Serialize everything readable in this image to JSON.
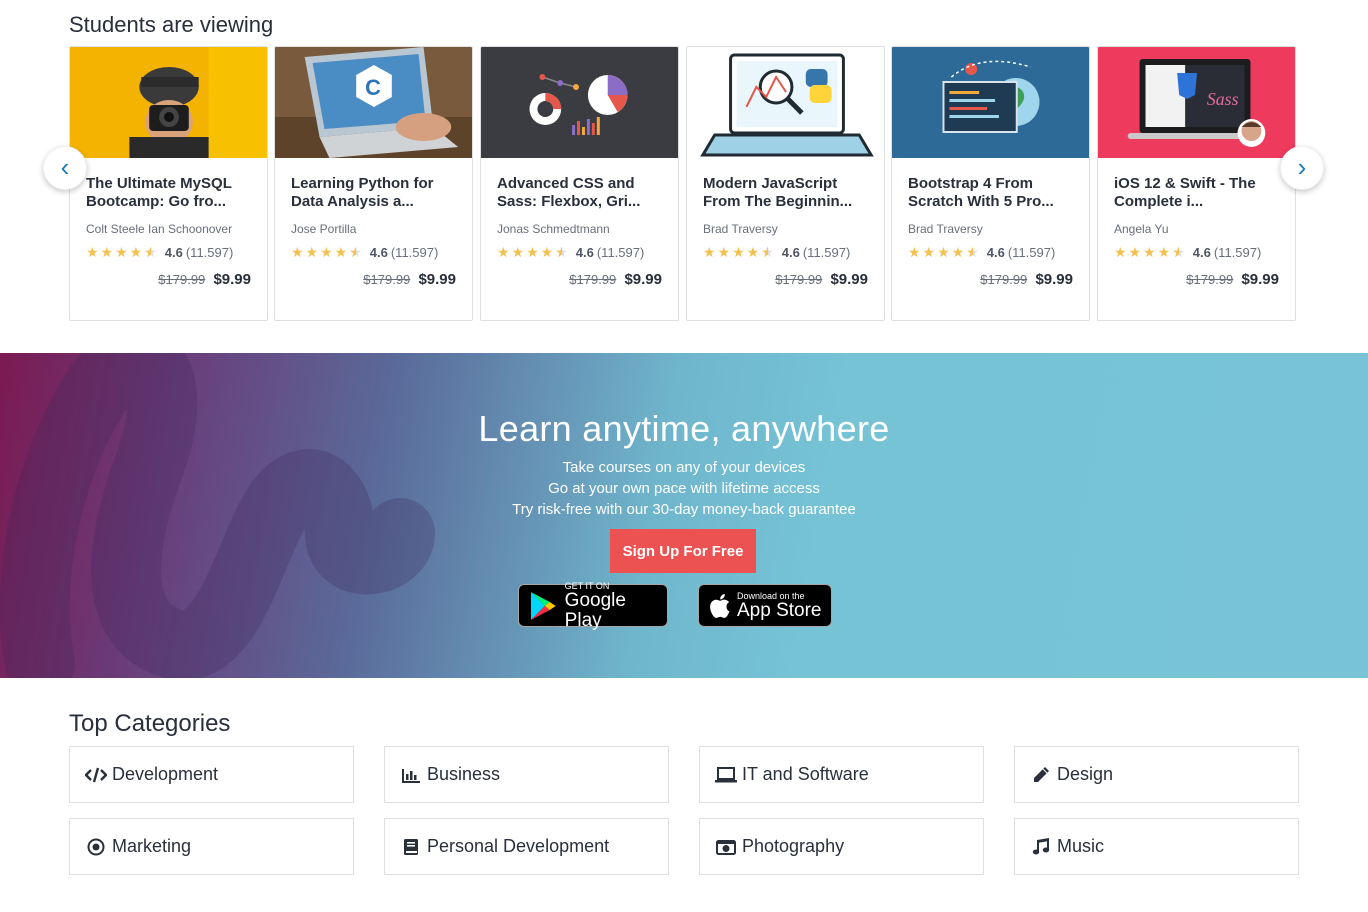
{
  "students_viewing": {
    "title": "Students are viewing",
    "prev_icon": "chevron-left-icon",
    "next_icon": "chevron-right-icon",
    "prev_glyph": "‹",
    "next_glyph": "›",
    "courses": [
      {
        "title": "The Ultimate MySQL Bootcamp: Go fro...",
        "author": "Colt Steele Ian Schoonover",
        "rating": "4.6",
        "count": "(11.597)",
        "old_price": "$179.99",
        "price": "$9.99"
      },
      {
        "title": "Learning Python for Data Analysis a...",
        "author": "Jose Portilla",
        "rating": "4.6",
        "count": "(11.597)",
        "old_price": "$179.99",
        "price": "$9.99"
      },
      {
        "title": "Advanced CSS and Sass: Flexbox, Gri...",
        "author": "Jonas Schmedtmann",
        "rating": "4.6",
        "count": "(11.597)",
        "old_price": "$179.99",
        "price": "$9.99"
      },
      {
        "title": "Modern JavaScript From The Beginnin...",
        "author": "Brad Traversy",
        "rating": "4.6",
        "count": "(11.597)",
        "old_price": "$179.99",
        "price": "$9.99"
      },
      {
        "title": "Bootstrap 4 From Scratch With 5 Pro...",
        "author": "Brad Traversy",
        "rating": "4.6",
        "count": "(11.597)",
        "old_price": "$179.99",
        "price": "$9.99"
      },
      {
        "title": "iOS 12 & Swift - The Complete i...",
        "author": "Angela Yu",
        "rating": "4.6",
        "count": "(11.597)",
        "old_price": "$179.99",
        "price": "$9.99"
      }
    ]
  },
  "banner": {
    "title": "Learn anytime, anywhere",
    "line1": "Take courses on any of your devices",
    "line2": "Go at your own pace with lifetime access",
    "line3": "Try risk-free with our 30-day money-back guarantee",
    "signup": "Sign Up For Free",
    "google_small": "GET IT ON",
    "google_big": "Google Play",
    "apple_small": "Download on the",
    "apple_big": "App Store"
  },
  "categories": {
    "title": "Top Categories",
    "items": [
      {
        "label": "Development",
        "icon": "code-icon"
      },
      {
        "label": "Business",
        "icon": "bar-chart-icon"
      },
      {
        "label": "IT and Software",
        "icon": "laptop-icon"
      },
      {
        "label": "Design",
        "icon": "pencil-icon"
      },
      {
        "label": "Marketing",
        "icon": "target-icon"
      },
      {
        "label": "Personal Development",
        "icon": "book-icon"
      },
      {
        "label": "Photography",
        "icon": "camera-icon"
      },
      {
        "label": "Music",
        "icon": "music-note-icon"
      }
    ]
  },
  "colors": {
    "accent": "#ec5252",
    "star": "#f4c150",
    "link": "#1a7ab8",
    "text": "#29303b"
  }
}
